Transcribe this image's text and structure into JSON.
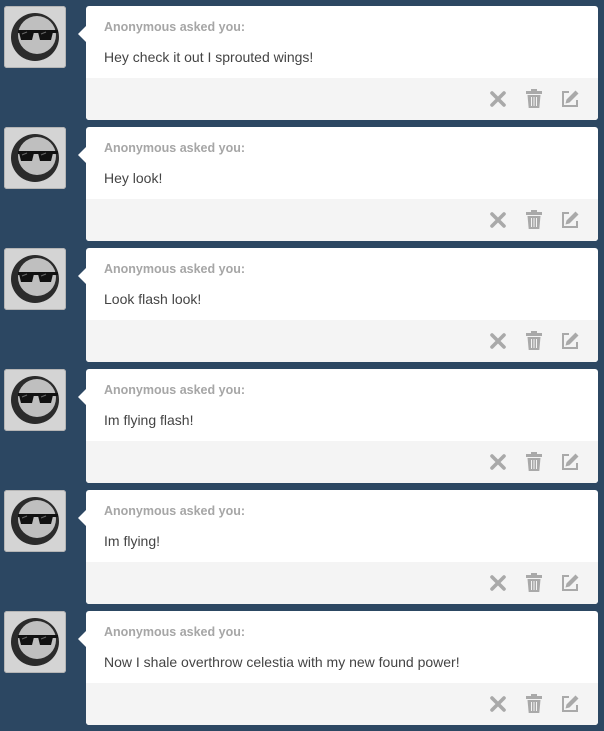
{
  "feed": {
    "posts": [
      {
        "asker": "Anonymous asked you:",
        "message": "Hey check it out I sprouted wings!"
      },
      {
        "asker": "Anonymous asked you:",
        "message": "Hey look!"
      },
      {
        "asker": "Anonymous asked you:",
        "message": "Look flash look!"
      },
      {
        "asker": "Anonymous asked you:",
        "message": "Im flying flash!"
      },
      {
        "asker": "Anonymous asked you:",
        "message": "Im flying!"
      },
      {
        "asker": "Anonymous asked you:",
        "message": "Now I shale overthrow celestia with my new found power!"
      }
    ],
    "actions": [
      "close-icon",
      "trash-icon",
      "edit-icon"
    ]
  },
  "colors": {
    "background": "#2c4762",
    "card": "#ffffff",
    "footer": "#f4f4f4",
    "icon": "#a9a9a9",
    "asker_text": "#a6a6a6",
    "message_text": "#444444"
  }
}
